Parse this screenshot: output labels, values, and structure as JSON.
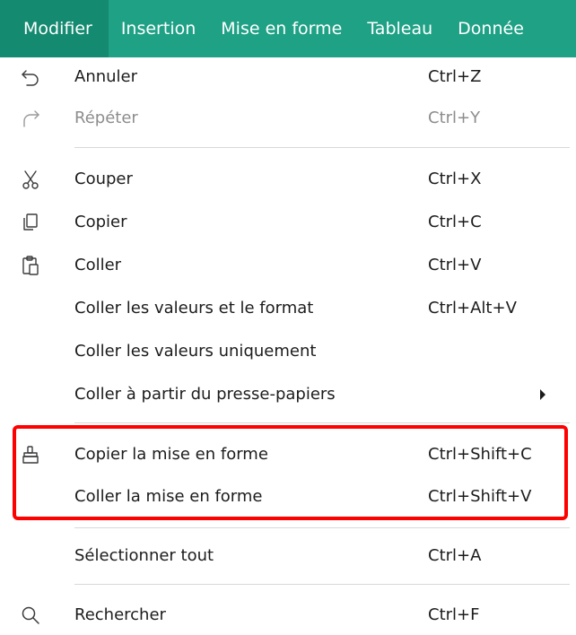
{
  "menubar": {
    "items": [
      {
        "label": "Modifier"
      },
      {
        "label": "Insertion"
      },
      {
        "label": "Mise en forme"
      },
      {
        "label": "Tableau"
      },
      {
        "label": "Donnée"
      }
    ]
  },
  "menu": {
    "items": [
      {
        "label": "Annuler",
        "shortcut": "Ctrl+Z",
        "icon": "undo-icon"
      },
      {
        "label": "Répéter",
        "shortcut": "Ctrl+Y",
        "icon": "redo-icon",
        "disabled": true
      },
      {
        "label": "Couper",
        "shortcut": "Ctrl+X",
        "icon": "cut-icon"
      },
      {
        "label": "Copier",
        "shortcut": "Ctrl+C",
        "icon": "copy-icon"
      },
      {
        "label": "Coller",
        "shortcut": "Ctrl+V",
        "icon": "paste-icon"
      },
      {
        "label": "Coller les valeurs et le format",
        "shortcut": "Ctrl+Alt+V"
      },
      {
        "label": "Coller les valeurs uniquement",
        "shortcut": ""
      },
      {
        "label": "Coller à partir du presse-papiers",
        "shortcut": "",
        "submenu": true
      },
      {
        "label": "Copier la mise en forme",
        "shortcut": "Ctrl+Shift+C",
        "icon": "format-painter-icon"
      },
      {
        "label": "Coller la mise en forme",
        "shortcut": "Ctrl+Shift+V"
      },
      {
        "label": "Sélectionner tout",
        "shortcut": "Ctrl+A"
      },
      {
        "label": "Rechercher",
        "shortcut": "Ctrl+F",
        "icon": "search-icon"
      }
    ]
  },
  "colors": {
    "menubar_bg": "#1fa185",
    "menubar_active_bg": "#148a70",
    "highlight_border": "#ff0000"
  }
}
